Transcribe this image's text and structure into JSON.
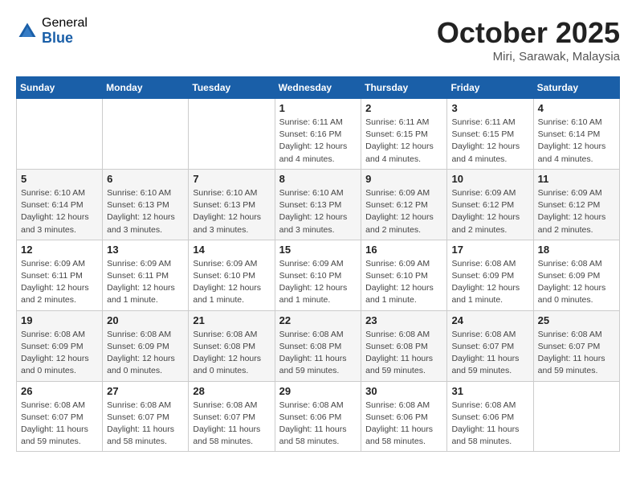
{
  "header": {
    "logo_general": "General",
    "logo_blue": "Blue",
    "month": "October 2025",
    "location": "Miri, Sarawak, Malaysia"
  },
  "weekdays": [
    "Sunday",
    "Monday",
    "Tuesday",
    "Wednesday",
    "Thursday",
    "Friday",
    "Saturday"
  ],
  "weeks": [
    [
      {
        "day": "",
        "info": ""
      },
      {
        "day": "",
        "info": ""
      },
      {
        "day": "",
        "info": ""
      },
      {
        "day": "1",
        "info": "Sunrise: 6:11 AM\nSunset: 6:16 PM\nDaylight: 12 hours\nand 4 minutes."
      },
      {
        "day": "2",
        "info": "Sunrise: 6:11 AM\nSunset: 6:15 PM\nDaylight: 12 hours\nand 4 minutes."
      },
      {
        "day": "3",
        "info": "Sunrise: 6:11 AM\nSunset: 6:15 PM\nDaylight: 12 hours\nand 4 minutes."
      },
      {
        "day": "4",
        "info": "Sunrise: 6:10 AM\nSunset: 6:14 PM\nDaylight: 12 hours\nand 4 minutes."
      }
    ],
    [
      {
        "day": "5",
        "info": "Sunrise: 6:10 AM\nSunset: 6:14 PM\nDaylight: 12 hours\nand 3 minutes."
      },
      {
        "day": "6",
        "info": "Sunrise: 6:10 AM\nSunset: 6:13 PM\nDaylight: 12 hours\nand 3 minutes."
      },
      {
        "day": "7",
        "info": "Sunrise: 6:10 AM\nSunset: 6:13 PM\nDaylight: 12 hours\nand 3 minutes."
      },
      {
        "day": "8",
        "info": "Sunrise: 6:10 AM\nSunset: 6:13 PM\nDaylight: 12 hours\nand 3 minutes."
      },
      {
        "day": "9",
        "info": "Sunrise: 6:09 AM\nSunset: 6:12 PM\nDaylight: 12 hours\nand 2 minutes."
      },
      {
        "day": "10",
        "info": "Sunrise: 6:09 AM\nSunset: 6:12 PM\nDaylight: 12 hours\nand 2 minutes."
      },
      {
        "day": "11",
        "info": "Sunrise: 6:09 AM\nSunset: 6:12 PM\nDaylight: 12 hours\nand 2 minutes."
      }
    ],
    [
      {
        "day": "12",
        "info": "Sunrise: 6:09 AM\nSunset: 6:11 PM\nDaylight: 12 hours\nand 2 minutes."
      },
      {
        "day": "13",
        "info": "Sunrise: 6:09 AM\nSunset: 6:11 PM\nDaylight: 12 hours\nand 1 minute."
      },
      {
        "day": "14",
        "info": "Sunrise: 6:09 AM\nSunset: 6:10 PM\nDaylight: 12 hours\nand 1 minute."
      },
      {
        "day": "15",
        "info": "Sunrise: 6:09 AM\nSunset: 6:10 PM\nDaylight: 12 hours\nand 1 minute."
      },
      {
        "day": "16",
        "info": "Sunrise: 6:09 AM\nSunset: 6:10 PM\nDaylight: 12 hours\nand 1 minute."
      },
      {
        "day": "17",
        "info": "Sunrise: 6:08 AM\nSunset: 6:09 PM\nDaylight: 12 hours\nand 1 minute."
      },
      {
        "day": "18",
        "info": "Sunrise: 6:08 AM\nSunset: 6:09 PM\nDaylight: 12 hours\nand 0 minutes."
      }
    ],
    [
      {
        "day": "19",
        "info": "Sunrise: 6:08 AM\nSunset: 6:09 PM\nDaylight: 12 hours\nand 0 minutes."
      },
      {
        "day": "20",
        "info": "Sunrise: 6:08 AM\nSunset: 6:09 PM\nDaylight: 12 hours\nand 0 minutes."
      },
      {
        "day": "21",
        "info": "Sunrise: 6:08 AM\nSunset: 6:08 PM\nDaylight: 12 hours\nand 0 minutes."
      },
      {
        "day": "22",
        "info": "Sunrise: 6:08 AM\nSunset: 6:08 PM\nDaylight: 11 hours\nand 59 minutes."
      },
      {
        "day": "23",
        "info": "Sunrise: 6:08 AM\nSunset: 6:08 PM\nDaylight: 11 hours\nand 59 minutes."
      },
      {
        "day": "24",
        "info": "Sunrise: 6:08 AM\nSunset: 6:07 PM\nDaylight: 11 hours\nand 59 minutes."
      },
      {
        "day": "25",
        "info": "Sunrise: 6:08 AM\nSunset: 6:07 PM\nDaylight: 11 hours\nand 59 minutes."
      }
    ],
    [
      {
        "day": "26",
        "info": "Sunrise: 6:08 AM\nSunset: 6:07 PM\nDaylight: 11 hours\nand 59 minutes."
      },
      {
        "day": "27",
        "info": "Sunrise: 6:08 AM\nSunset: 6:07 PM\nDaylight: 11 hours\nand 58 minutes."
      },
      {
        "day": "28",
        "info": "Sunrise: 6:08 AM\nSunset: 6:07 PM\nDaylight: 11 hours\nand 58 minutes."
      },
      {
        "day": "29",
        "info": "Sunrise: 6:08 AM\nSunset: 6:06 PM\nDaylight: 11 hours\nand 58 minutes."
      },
      {
        "day": "30",
        "info": "Sunrise: 6:08 AM\nSunset: 6:06 PM\nDaylight: 11 hours\nand 58 minutes."
      },
      {
        "day": "31",
        "info": "Sunrise: 6:08 AM\nSunset: 6:06 PM\nDaylight: 11 hours\nand 58 minutes."
      },
      {
        "day": "",
        "info": ""
      }
    ]
  ]
}
